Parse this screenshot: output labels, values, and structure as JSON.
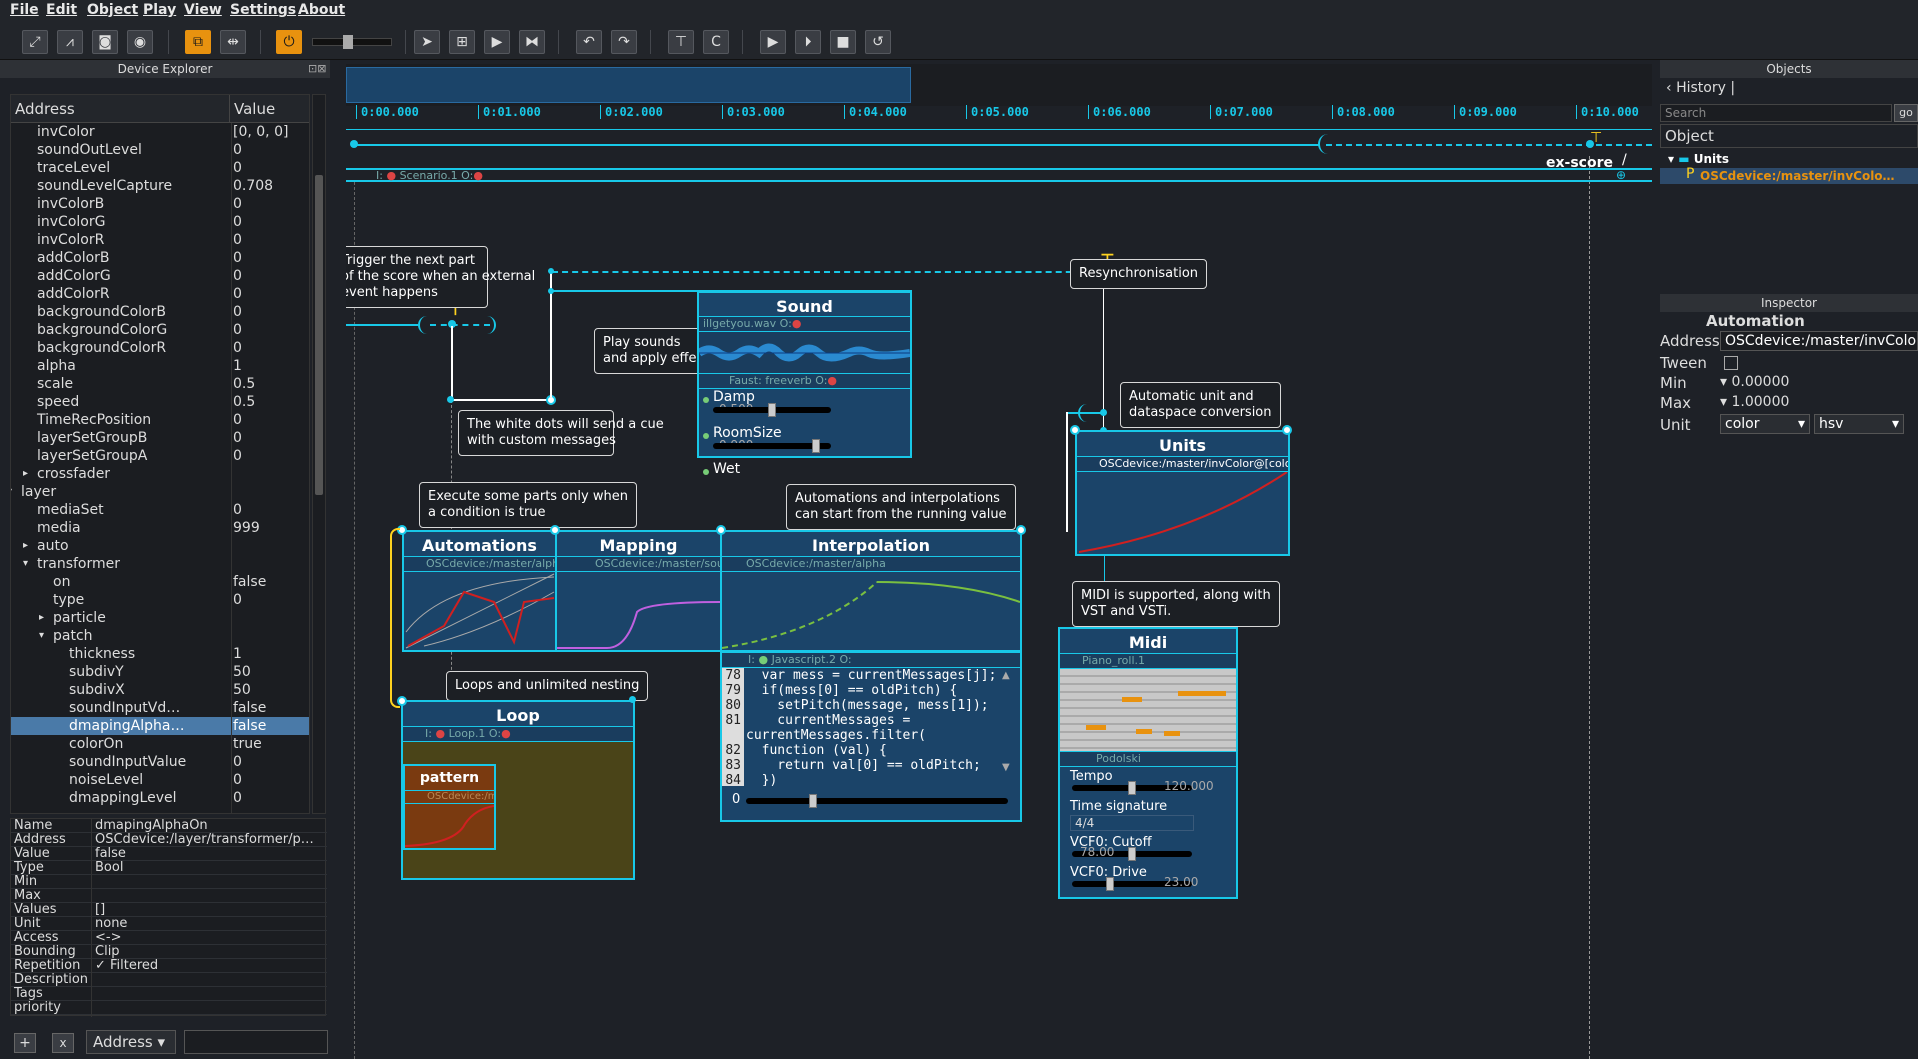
{
  "menu": [
    "File",
    "Edit",
    "Object",
    "Play",
    "View",
    "Settings",
    "About"
  ],
  "device_explorer": {
    "title": "Device Explorer",
    "col_address": "Address",
    "col_value": "Value",
    "rows": [
      {
        "name": "invColor",
        "value": "[0, 0, 0]",
        "indent": 3
      },
      {
        "name": "soundOutLevel",
        "value": "0",
        "indent": 3
      },
      {
        "name": "traceLevel",
        "value": "0",
        "indent": 3
      },
      {
        "name": "soundLevelCapture",
        "value": "0.708",
        "indent": 3
      },
      {
        "name": "invColorB",
        "value": "0",
        "indent": 3
      },
      {
        "name": "invColorG",
        "value": "0",
        "indent": 3
      },
      {
        "name": "invColorR",
        "value": "0",
        "indent": 3
      },
      {
        "name": "addColorB",
        "value": "0",
        "indent": 3
      },
      {
        "name": "addColorG",
        "value": "0",
        "indent": 3
      },
      {
        "name": "addColorR",
        "value": "0",
        "indent": 3
      },
      {
        "name": "backgroundColorB",
        "value": "0",
        "indent": 3
      },
      {
        "name": "backgroundColorG",
        "value": "0",
        "indent": 3
      },
      {
        "name": "backgroundColorR",
        "value": "0",
        "indent": 3
      },
      {
        "name": "alpha",
        "value": "1",
        "indent": 3
      },
      {
        "name": "scale",
        "value": "0.5",
        "indent": 3
      },
      {
        "name": "speed",
        "value": "0.5",
        "indent": 3
      },
      {
        "name": "TimeRecPosition",
        "value": "0",
        "indent": 3
      },
      {
        "name": "layerSetGroupB",
        "value": "0",
        "indent": 3
      },
      {
        "name": "layerSetGroupA",
        "value": "0",
        "indent": 3
      },
      {
        "name": "crossfader",
        "value": "",
        "indent": 3,
        "arrow": "▸"
      },
      {
        "name": "layer",
        "value": "",
        "indent": 2,
        "arrow": "▾"
      },
      {
        "name": "mediaSet",
        "value": "0",
        "indent": 3
      },
      {
        "name": "media",
        "value": "999",
        "indent": 3
      },
      {
        "name": "auto",
        "value": "",
        "indent": 3,
        "arrow": "▸"
      },
      {
        "name": "transformer",
        "value": "",
        "indent": 3,
        "arrow": "▾"
      },
      {
        "name": "on",
        "value": "false",
        "indent": 4
      },
      {
        "name": "type",
        "value": "0",
        "indent": 4
      },
      {
        "name": "particle",
        "value": "",
        "indent": 4,
        "arrow": "▸"
      },
      {
        "name": "patch",
        "value": "",
        "indent": 4,
        "arrow": "▾"
      },
      {
        "name": "thickness",
        "value": "1",
        "indent": 5
      },
      {
        "name": "subdivY",
        "value": "50",
        "indent": 5
      },
      {
        "name": "subdivX",
        "value": "50",
        "indent": 5
      },
      {
        "name": "soundInputVd…",
        "value": "false",
        "indent": 5
      },
      {
        "name": "dmapingAlpha…",
        "value": "false",
        "indent": 5,
        "selected": true
      },
      {
        "name": "colorOn",
        "value": "true",
        "indent": 5
      },
      {
        "name": "soundInputValue",
        "value": "0",
        "indent": 5
      },
      {
        "name": "noiseLevel",
        "value": "0",
        "indent": 5
      },
      {
        "name": "dmappingLevel",
        "value": "0",
        "indent": 5
      }
    ]
  },
  "properties": [
    {
      "k": "Name",
      "v": "dmapingAlphaOn"
    },
    {
      "k": "Address",
      "v": "OSCdevice:/layer/transformer/p…"
    },
    {
      "k": "Value",
      "v": "    false"
    },
    {
      "k": "Type",
      "v": "Bool"
    },
    {
      "k": "Min",
      "v": ""
    },
    {
      "k": "Max",
      "v": ""
    },
    {
      "k": "Values",
      "v": "[]"
    },
    {
      "k": "Unit",
      "v": "none"
    },
    {
      "k": "Access",
      "v": "<->"
    },
    {
      "k": "Bounding",
      "v": "Clip"
    },
    {
      "k": "Repetition",
      "v": "✓ Filtered"
    },
    {
      "k": "Description",
      "v": ""
    },
    {
      "k": "Tags",
      "v": ""
    },
    {
      "k": "priority",
      "v": ""
    }
  ],
  "bottom_bar": {
    "address_select": "Address",
    "add": "+",
    "remove": "x"
  },
  "ruler": [
    "0:00.000",
    "0:01.000",
    "0:02.000",
    "0:03.000",
    "0:04.000",
    "0:05.000",
    "0:06.000",
    "0:07.000",
    "0:08.000",
    "0:09.000",
    "0:10.000"
  ],
  "scenario_label": "Scenario.1",
  "ex_score": "ex-score",
  "notes": {
    "trigger": "Trigger the next part\nof the score when an external\nevent happens",
    "white_dots": "The white dots will send a cue\nwith custom messages",
    "play_sounds": "Play sounds\nand apply effects",
    "resync": "Resynchronisation",
    "units_note": "Automatic unit and\ndataspace conversion",
    "execute": "Execute some parts only when\na condition is true",
    "automations_note": "Automations and interpolations\ncan start from the running value",
    "loops": "Loops and unlimited nesting",
    "midi_note": "MIDI is supported, along with\nVST and VSTi."
  },
  "sound_box": {
    "title": "Sound",
    "proc1": "illgetyou.wav",
    "proc2": "Faust: freeverb",
    "params": [
      {
        "name": "Damp",
        "value": "0.500",
        "level": 0.5
      },
      {
        "name": "RoomSize",
        "value": "0.900",
        "level": 0.9
      },
      {
        "name": "Wet",
        "value": "",
        "level": 0
      }
    ]
  },
  "units_box": {
    "title": "Units",
    "proc": "OSCdevice:/master/invColor@[color.hsv.h]"
  },
  "automations_box": {
    "title": "Automations",
    "proc": "OSCdevice:/master/alpha"
  },
  "mapping_box": {
    "title": "Mapping",
    "proc": "OSCdevice:/master/sound"
  },
  "interpolation_box": {
    "title": "Interpolation",
    "proc": "OSCdevice:/master/alpha"
  },
  "js_box": {
    "proc": "Javascript.2",
    "lines": [
      {
        "n": "78",
        "t": "  var mess = currentMessages[j];"
      },
      {
        "n": "79",
        "t": "  if(mess[0] == oldPitch) {"
      },
      {
        "n": "80",
        "t": "    setPitch(message, mess[1]);"
      },
      {
        "n": "81",
        "t": "    currentMessages ="
      },
      {
        "n": "",
        "t": "currentMessages.filter("
      },
      {
        "n": "82",
        "t": "  function (val) {"
      },
      {
        "n": "83",
        "t": "    return val[0] == oldPitch;"
      },
      {
        "n": "84",
        "t": "  })"
      }
    ],
    "slider_value": "0",
    "slider_level": 0.25
  },
  "loop_box": {
    "title": "Loop",
    "proc": "Loop.1"
  },
  "pattern_box": {
    "title": "pattern",
    "proc": "OSCdevice:/m"
  },
  "midi_box": {
    "title": "Midi",
    "proc1": "Piano_roll.1",
    "proc2": "Podolski",
    "tempo_label": "Tempo",
    "tempo_value": "120.000",
    "tempo_level": 0.5,
    "timesig_label": "Time signature",
    "timesig_value": "4/4",
    "cutoff_label": "VCF0: Cutoff",
    "cutoff_value": "78.00",
    "cutoff_level": 0.5,
    "drive_label": "VCF0: Drive",
    "drive_value": "23.00",
    "drive_level": 0.3
  },
  "objects_panel": {
    "title": "Objects",
    "history": "History",
    "search_placeholder": "Search",
    "go": "go",
    "col": "Object",
    "tree_root": "Units",
    "tree_child": "OSCdevice:/master/invColo…"
  },
  "inspector": {
    "title": "Inspector",
    "heading": "Automation",
    "address_label": "Address",
    "address_value": "OSCdevice:/master/invColor(",
    "tween_label": "Tween",
    "min_label": "Min",
    "min_value": "0.00000",
    "max_label": "Max",
    "max_value": "1.00000",
    "unit_label": "Unit",
    "unit_value": "color",
    "unit_sub": "hsv"
  },
  "colors": {
    "accent": "#18c8e8",
    "box": "#1b4469",
    "orange": "#e8920f",
    "red": "#d02020"
  }
}
